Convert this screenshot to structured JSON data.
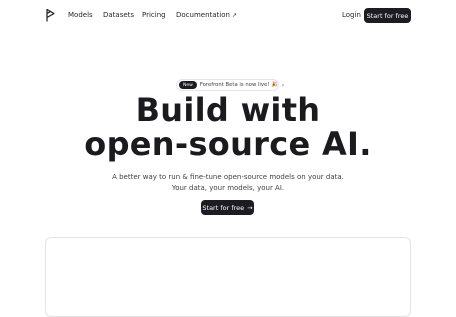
{
  "nav": {
    "links": [
      {
        "label": "Models"
      },
      {
        "label": "Datasets"
      },
      {
        "label": "Pricing"
      },
      {
        "label": "Documentation",
        "arrow": "↗"
      }
    ],
    "login": "Login",
    "cta": "Start for free"
  },
  "badge": {
    "tag": "New",
    "text": "Forefront Beta is now live! 🎉",
    "chevron": "›"
  },
  "hero": {
    "line1": "Build with",
    "line2": "open-source AI.",
    "sub_line1": "A better way to run & fine-tune open-source models on your data.",
    "sub_line2": "Your data, your models, your AI.",
    "cta": "Start for free",
    "cta_arrow": "→"
  },
  "colors": {
    "accent_dark": "#1c1c22",
    "border": "#e4e4e7"
  },
  "icons": {
    "logo": "forefront-logo-icon"
  }
}
